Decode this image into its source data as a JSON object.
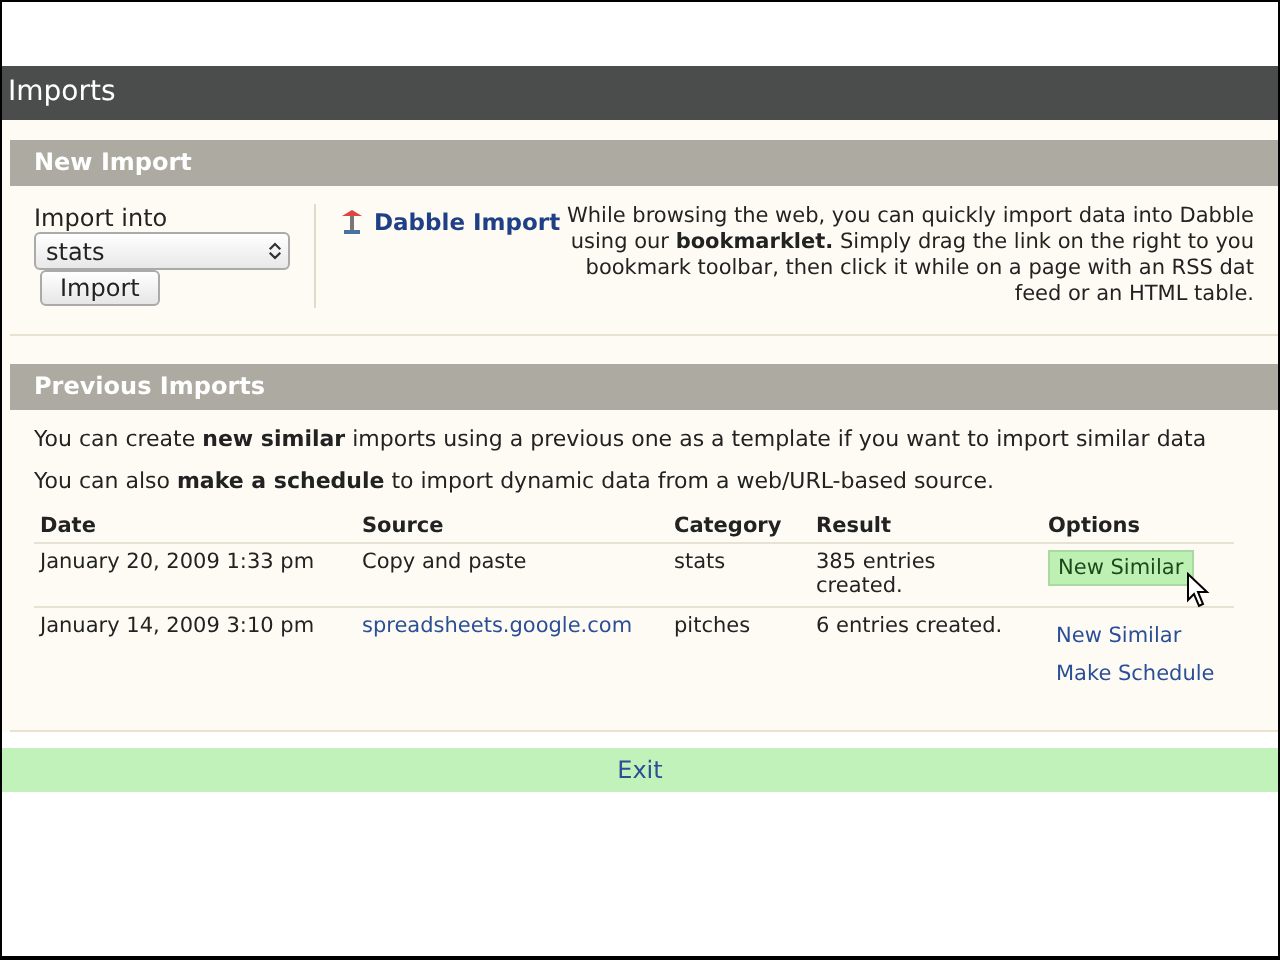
{
  "page": {
    "title": "Imports"
  },
  "new_import": {
    "title": "New Import",
    "import_into_label": "Import into",
    "select_value": "stats",
    "import_button": "Import",
    "bookmarklet_link": "Dabble Import",
    "description": "While browsing the web, you can quickly import data into Dabble using our **bookmarklet.** Simply drag the link on the right to you bookmark toolbar, then click it while on a page with an RSS dat feed or an HTML table."
  },
  "previous_imports": {
    "title": "Previous Imports",
    "intro": [
      "You can create **new similar** imports using a previous one as a template if you want to import similar data",
      "You can also **make a schedule** to import dynamic data from a web/URL-based source."
    ],
    "columns": [
      "Date",
      "Source",
      "Category",
      "Result",
      "Options"
    ],
    "rows": [
      {
        "date": "January 20, 2009 1:33 pm",
        "source": "Copy and paste",
        "source_link": false,
        "category": "stats",
        "result": "385 entries created.",
        "options": [
          {
            "label": "New Similar",
            "highlighted": true
          }
        ]
      },
      {
        "date": "January 14, 2009 3:10 pm",
        "source": "spreadsheets.google.com",
        "source_link": true,
        "category": "pitches",
        "result": "6 entries created.",
        "options": [
          {
            "label": "New Similar",
            "highlighted": false
          },
          {
            "label": "Make Schedule",
            "highlighted": false
          }
        ]
      }
    ]
  },
  "exit_button": "Exit"
}
